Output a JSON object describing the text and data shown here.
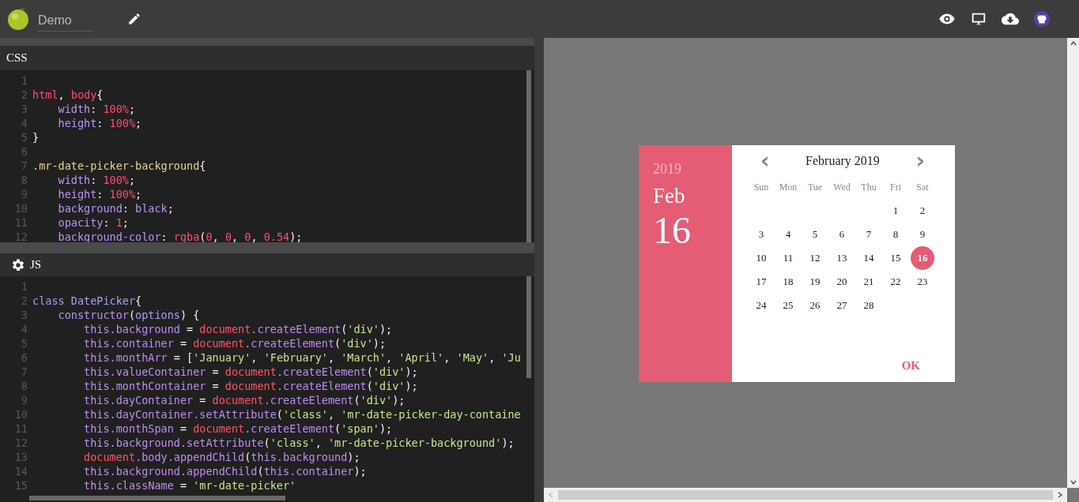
{
  "app": {
    "title": "Demo"
  },
  "panels": [
    {
      "title": "CSS",
      "lines": [
        {
          "number": "1"
        },
        {
          "number": "2",
          "tokens": [
            {
              "kind": "tag",
              "text": "html"
            },
            {
              "kind": "plain",
              "text": ", "
            },
            {
              "kind": "tag",
              "text": "body"
            },
            {
              "kind": "plain",
              "text": "{"
            }
          ]
        },
        {
          "number": "3",
          "tokens": [
            {
              "kind": "property",
              "text": "    width"
            },
            {
              "kind": "plain",
              "text": ": "
            },
            {
              "kind": "number",
              "text": "100%"
            },
            {
              "kind": "plain",
              "text": ";"
            }
          ]
        },
        {
          "number": "4",
          "tokens": [
            {
              "kind": "property",
              "text": "    height"
            },
            {
              "kind": "plain",
              "text": ": "
            },
            {
              "kind": "number",
              "text": "100%"
            },
            {
              "kind": "plain",
              "text": ";"
            }
          ]
        },
        {
          "number": "5",
          "tokens": [
            {
              "kind": "plain",
              "text": "}"
            }
          ]
        },
        {
          "number": "6"
        },
        {
          "number": "7",
          "tokens": [
            {
              "kind": "selector",
              "text": ".mr-date-picker-background"
            },
            {
              "kind": "plain",
              "text": "{"
            }
          ]
        },
        {
          "number": "8",
          "tokens": [
            {
              "kind": "property",
              "text": "    width"
            },
            {
              "kind": "plain",
              "text": ": "
            },
            {
              "kind": "number",
              "text": "100%"
            },
            {
              "kind": "plain",
              "text": ";"
            }
          ]
        },
        {
          "number": "9",
          "tokens": [
            {
              "kind": "property",
              "text": "    height"
            },
            {
              "kind": "plain",
              "text": ": "
            },
            {
              "kind": "number",
              "text": "100%"
            },
            {
              "kind": "plain",
              "text": ";"
            }
          ]
        },
        {
          "number": "10",
          "tokens": [
            {
              "kind": "property",
              "text": "    background"
            },
            {
              "kind": "plain",
              "text": ": "
            },
            {
              "kind": "property",
              "text": "black"
            },
            {
              "kind": "plain",
              "text": ";"
            }
          ]
        },
        {
          "number": "11",
          "tokens": [
            {
              "kind": "property",
              "text": "    opacity"
            },
            {
              "kind": "plain",
              "text": ": "
            },
            {
              "kind": "number",
              "text": "1"
            },
            {
              "kind": "plain",
              "text": ";"
            }
          ]
        },
        {
          "number": "12",
          "tokens": [
            {
              "kind": "property",
              "text": "    background-color"
            },
            {
              "kind": "plain",
              "text": ": "
            },
            {
              "kind": "tag",
              "text": "rgba"
            },
            {
              "kind": "plain",
              "text": "("
            },
            {
              "kind": "number",
              "text": "0"
            },
            {
              "kind": "plain",
              "text": ", "
            },
            {
              "kind": "number",
              "text": "0"
            },
            {
              "kind": "plain",
              "text": ", "
            },
            {
              "kind": "number",
              "text": "0"
            },
            {
              "kind": "plain",
              "text": ", "
            },
            {
              "kind": "number",
              "text": "0.54"
            },
            {
              "kind": "plain",
              "text": ");"
            }
          ]
        }
      ]
    },
    {
      "title": "JS",
      "lines": [
        {
          "number": "1"
        },
        {
          "number": "2",
          "tokens": [
            {
              "kind": "keyword",
              "text": "class"
            },
            {
              "kind": "name",
              "text": " DatePicker"
            },
            {
              "kind": "plain",
              "text": "{"
            }
          ]
        },
        {
          "number": "3",
          "tokens": [
            {
              "kind": "keyword",
              "text": "    constructor"
            },
            {
              "kind": "plain",
              "text": "("
            },
            {
              "kind": "name",
              "text": "options"
            },
            {
              "kind": "plain",
              "text": ") {"
            }
          ]
        },
        {
          "number": "4",
          "tokens": [
            {
              "kind": "member",
              "text": "        this.background"
            },
            {
              "kind": "plain",
              "text": " = "
            },
            {
              "kind": "global",
              "text": "document"
            },
            {
              "kind": "member",
              "text": ".createElement"
            },
            {
              "kind": "plain",
              "text": "("
            },
            {
              "kind": "string",
              "text": "'div'"
            },
            {
              "kind": "plain",
              "text": ");"
            }
          ]
        },
        {
          "number": "5",
          "tokens": [
            {
              "kind": "member",
              "text": "        this.container"
            },
            {
              "kind": "plain",
              "text": " = "
            },
            {
              "kind": "global",
              "text": "document"
            },
            {
              "kind": "member",
              "text": ".createElement"
            },
            {
              "kind": "plain",
              "text": "("
            },
            {
              "kind": "string",
              "text": "'div'"
            },
            {
              "kind": "plain",
              "text": ");"
            }
          ]
        },
        {
          "number": "6",
          "tokens": [
            {
              "kind": "member",
              "text": "        this.monthArr"
            },
            {
              "kind": "plain",
              "text": " = ["
            },
            {
              "kind": "string",
              "text": "'January'"
            },
            {
              "kind": "plain",
              "text": ", "
            },
            {
              "kind": "string",
              "text": "'February'"
            },
            {
              "kind": "plain",
              "text": ", "
            },
            {
              "kind": "string",
              "text": "'March'"
            },
            {
              "kind": "plain",
              "text": ", "
            },
            {
              "kind": "string",
              "text": "'April'"
            },
            {
              "kind": "plain",
              "text": ", "
            },
            {
              "kind": "string",
              "text": "'May'"
            },
            {
              "kind": "plain",
              "text": ", "
            },
            {
              "kind": "string",
              "text": "'Ju"
            }
          ]
        },
        {
          "number": "7",
          "tokens": [
            {
              "kind": "member",
              "text": "        this.valueContainer"
            },
            {
              "kind": "plain",
              "text": " = "
            },
            {
              "kind": "global",
              "text": "document"
            },
            {
              "kind": "member",
              "text": ".createElement"
            },
            {
              "kind": "plain",
              "text": "("
            },
            {
              "kind": "string",
              "text": "'div'"
            },
            {
              "kind": "plain",
              "text": ");"
            }
          ]
        },
        {
          "number": "8",
          "tokens": [
            {
              "kind": "member",
              "text": "        this.monthContainer"
            },
            {
              "kind": "plain",
              "text": " = "
            },
            {
              "kind": "global",
              "text": "document"
            },
            {
              "kind": "member",
              "text": ".createElement"
            },
            {
              "kind": "plain",
              "text": "("
            },
            {
              "kind": "string",
              "text": "'div'"
            },
            {
              "kind": "plain",
              "text": ");"
            }
          ]
        },
        {
          "number": "9",
          "tokens": [
            {
              "kind": "member",
              "text": "        this.dayContainer"
            },
            {
              "kind": "plain",
              "text": " = "
            },
            {
              "kind": "global",
              "text": "document"
            },
            {
              "kind": "member",
              "text": ".createElement"
            },
            {
              "kind": "plain",
              "text": "("
            },
            {
              "kind": "string",
              "text": "'div'"
            },
            {
              "kind": "plain",
              "text": ");"
            }
          ]
        },
        {
          "number": "10",
          "tokens": [
            {
              "kind": "member",
              "text": "        this.dayContainer.setAttribute"
            },
            {
              "kind": "plain",
              "text": "("
            },
            {
              "kind": "string",
              "text": "'class'"
            },
            {
              "kind": "plain",
              "text": ", "
            },
            {
              "kind": "string",
              "text": "'mr-date-picker-day-containe"
            }
          ]
        },
        {
          "number": "11",
          "tokens": [
            {
              "kind": "member",
              "text": "        this.monthSpan"
            },
            {
              "kind": "plain",
              "text": " = "
            },
            {
              "kind": "global",
              "text": "document"
            },
            {
              "kind": "member",
              "text": ".createElement"
            },
            {
              "kind": "plain",
              "text": "("
            },
            {
              "kind": "string",
              "text": "'span'"
            },
            {
              "kind": "plain",
              "text": ");"
            }
          ]
        },
        {
          "number": "12",
          "tokens": [
            {
              "kind": "member",
              "text": "        this.background.setAttribute"
            },
            {
              "kind": "plain",
              "text": "("
            },
            {
              "kind": "string",
              "text": "'class'"
            },
            {
              "kind": "plain",
              "text": ", "
            },
            {
              "kind": "string",
              "text": "'mr-date-picker-background'"
            },
            {
              "kind": "plain",
              "text": ");"
            }
          ]
        },
        {
          "number": "13",
          "tokens": [
            {
              "kind": "global",
              "text": "        document"
            },
            {
              "kind": "member",
              "text": ".body.appendChild"
            },
            {
              "kind": "plain",
              "text": "("
            },
            {
              "kind": "member",
              "text": "this.background"
            },
            {
              "kind": "plain",
              "text": ");"
            }
          ]
        },
        {
          "number": "14",
          "tokens": [
            {
              "kind": "member",
              "text": "        this.background.appendChild"
            },
            {
              "kind": "plain",
              "text": "("
            },
            {
              "kind": "member",
              "text": "this.container"
            },
            {
              "kind": "plain",
              "text": ");"
            }
          ]
        },
        {
          "number": "15",
          "tokens": [
            {
              "kind": "member",
              "text": "        this.className"
            },
            {
              "kind": "plain",
              "text": " = "
            },
            {
              "kind": "string",
              "text": "'mr-date-picker'"
            }
          ]
        }
      ]
    }
  ],
  "date_picker": {
    "year": "2019",
    "month": "Feb",
    "day": "16",
    "prev": "‹",
    "next": "›",
    "title": "February 2019",
    "weekdays": [
      "Sun",
      "Mon",
      "Tue",
      "Wed",
      "Thu",
      "Fri",
      "Sat"
    ],
    "weeks": [
      {
        "days": [
          {
            "label": "1",
            "selected": false
          },
          {
            "label": "2",
            "selected": false
          }
        ]
      },
      {
        "days": [
          {
            "label": "3",
            "selected": false
          },
          {
            "label": "4",
            "selected": false
          },
          {
            "label": "5",
            "selected": false
          },
          {
            "label": "6",
            "selected": false
          },
          {
            "label": "7",
            "selected": false
          },
          {
            "label": "8",
            "selected": false
          },
          {
            "label": "9",
            "selected": false
          }
        ]
      },
      {
        "days": [
          {
            "label": "10",
            "selected": false
          },
          {
            "label": "11",
            "selected": false
          },
          {
            "label": "12",
            "selected": false
          },
          {
            "label": "13",
            "selected": false
          },
          {
            "label": "14",
            "selected": false
          },
          {
            "label": "15",
            "selected": false
          },
          {
            "label": "16",
            "selected": true
          }
        ]
      },
      {
        "days": [
          {
            "label": "17",
            "selected": false
          },
          {
            "label": "18",
            "selected": false
          },
          {
            "label": "19",
            "selected": false
          },
          {
            "label": "20",
            "selected": false
          },
          {
            "label": "21",
            "selected": false
          },
          {
            "label": "22",
            "selected": false
          },
          {
            "label": "23",
            "selected": false
          }
        ]
      },
      {
        "days": [
          {
            "label": "24",
            "selected": false
          },
          {
            "label": "25",
            "selected": false
          },
          {
            "label": "26",
            "selected": false
          },
          {
            "label": "27",
            "selected": false
          },
          {
            "label": "28",
            "selected": false
          }
        ]
      }
    ],
    "ok": "OK"
  }
}
